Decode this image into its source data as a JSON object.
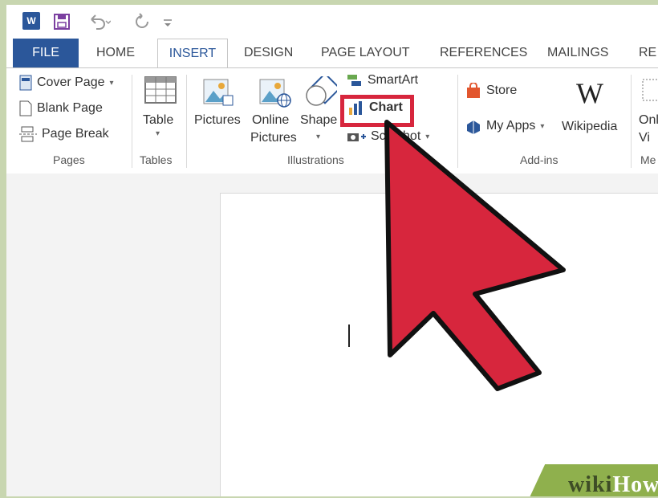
{
  "qat": {
    "word_logo": "W",
    "icons": [
      "word-app-icon",
      "save-icon",
      "undo-icon",
      "redo-icon",
      "customize-qat-icon"
    ]
  },
  "tabs": [
    "FILE",
    "HOME",
    "INSERT",
    "DESIGN",
    "PAGE LAYOUT",
    "REFERENCES",
    "MAILINGS",
    "RE"
  ],
  "active_tab": "INSERT",
  "groups": {
    "pages": {
      "label": "Pages",
      "items": [
        "Cover Page",
        "Blank Page",
        "Page Break"
      ]
    },
    "tables": {
      "label": "Tables",
      "table": "Table"
    },
    "illustrations": {
      "label": "Illustrations",
      "pictures": "Pictures",
      "online_pictures_1": "Online",
      "online_pictures_2": "Pictures",
      "shapes": "Shape",
      "smartart": "SmartArt",
      "chart": "Chart",
      "screenshot": "Sc   nshot"
    },
    "addins": {
      "label": "Add-ins",
      "store": "Store",
      "my_apps": "My Apps",
      "wikipedia": "Wikipedia",
      "wikipedia_logo": "W"
    },
    "media": {
      "label": "Me",
      "online_video_1": "Onl",
      "online_video_2": "Vi"
    }
  },
  "watermark": {
    "wiki": "wiki",
    "how": "How"
  },
  "colors": {
    "accent": "#2b579a",
    "highlight": "#d7263d",
    "arrow": "#d7263d"
  }
}
